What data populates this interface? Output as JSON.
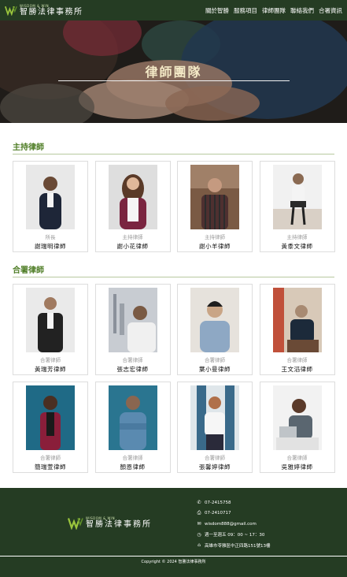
{
  "header": {
    "logo_en": "WISDOM & WIN",
    "logo_cn": "智勝法律事務所",
    "menu": [
      "關於智勝",
      "服務項目",
      "律師團隊",
      "聯絡我們",
      "合署資訊"
    ]
  },
  "hero": {
    "title": "律師團隊"
  },
  "sections": {
    "lead_title": "主持律師",
    "partner_title": "合署律師"
  },
  "lead_lawyers": [
    {
      "role": "所長",
      "name": "謝瑞明律師"
    },
    {
      "role": "主持律師",
      "name": "謝小花律師"
    },
    {
      "role": "主持律師",
      "name": "謝小羊律師"
    },
    {
      "role": "主持律師",
      "name": "黃黍文律師"
    }
  ],
  "partner_lawyers": [
    {
      "role": "合署律師",
      "name": "黃瑞芳律師"
    },
    {
      "role": "合署律師",
      "name": "張志宏律師"
    },
    {
      "role": "合署律師",
      "name": "葉小曼律師"
    },
    {
      "role": "合署律師",
      "name": "王文滔律師"
    },
    {
      "role": "合署律師",
      "name": "簡瑞萱律師"
    },
    {
      "role": "合署律師",
      "name": "顏恩律師"
    },
    {
      "role": "合署律師",
      "name": "張馨婷律師"
    },
    {
      "role": "合署律師",
      "name": "吳雅婷律師"
    }
  ],
  "footer": {
    "logo_en": "WISDOM & WIN",
    "logo_cn": "智勝法律事務所",
    "phone": "07-2415758",
    "fax": "07-2410717",
    "email": "wisdom888@gmail.com",
    "hours": "週一至週五 09：00 ~ 17：30",
    "address": "高雄市苓雅區中正四路151號13樓",
    "copyright": "Copyright © 2024 智勝法律事務所"
  },
  "colors": {
    "brand_dark": "#253c23",
    "accent_green": "#4e7d25"
  }
}
